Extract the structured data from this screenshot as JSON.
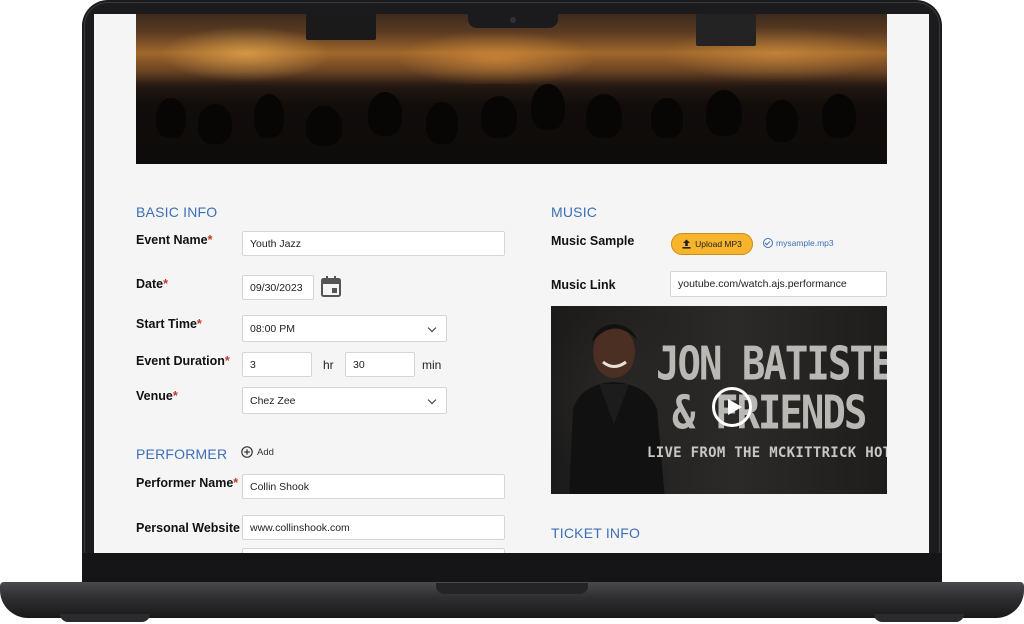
{
  "basic_info": {
    "heading": "BASIC INFO",
    "event_name_label": "Event Name",
    "event_name_value": "Youth Jazz",
    "date_label": "Date",
    "date_value": "09/30/2023",
    "start_time_label": "Start Time",
    "start_time_value": "08:00 PM",
    "duration_label": "Event Duration",
    "duration_hours": "3",
    "hours_unit": "hr",
    "duration_minutes": "30",
    "minutes_unit": "min",
    "venue_label": "Venue",
    "venue_value": "Chez Zee",
    "required_mark": "*"
  },
  "performer": {
    "heading": "PERFORMER",
    "add_label": "Add",
    "name_label": "Performer Name",
    "name_value": "Collin Shook",
    "website_label": "Personal Website",
    "website_value": "www.collinshook.com"
  },
  "music": {
    "heading": "MUSIC",
    "sample_label": "Music Sample",
    "upload_label": "Upload MP3",
    "file_name": "mysample.mp3",
    "link_label": "Music Link",
    "link_value": "youtube.com/watch.ajs.performance",
    "video": {
      "title_line1": "JON BATISTE",
      "title_line2": "& FRIENDS",
      "subtitle": "LIVE FROM THE MCKITTRICK HOTEL"
    }
  },
  "ticket_info": {
    "heading": "TICKET INFO"
  },
  "colors": {
    "accent": "#3c6fb8",
    "required": "#c0392b",
    "upload_button": "#f7b42c"
  }
}
